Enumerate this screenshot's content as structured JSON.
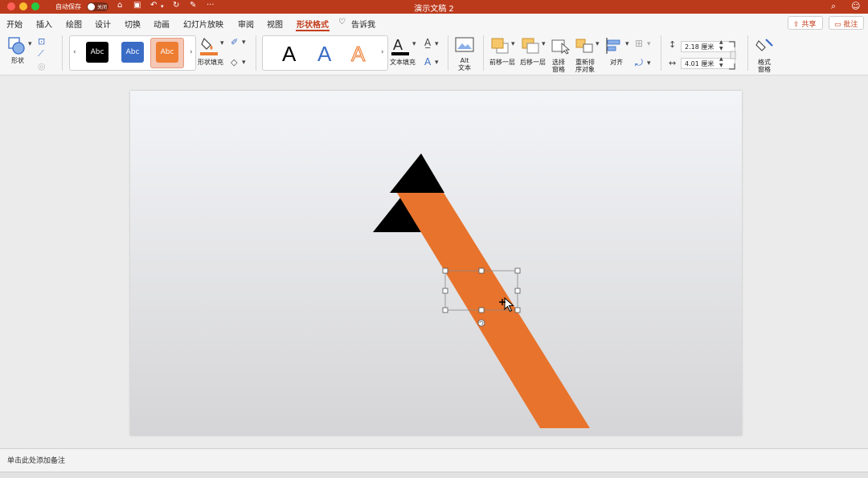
{
  "titlebar": {
    "autosave_label": "自动保存",
    "autosave_state": "关闭",
    "doc_title": "演示文稿 2",
    "more": "···"
  },
  "tabs": [
    "开始",
    "插入",
    "绘图",
    "设计",
    "切换",
    "动画",
    "幻灯片放映",
    "审阅",
    "视图",
    "形状格式"
  ],
  "tell_me": "告诉我",
  "share_label": "共享",
  "comment_label": "批注",
  "ribbon": {
    "shape_label": "形状",
    "style_sample": "Abc",
    "shape_fill_label": "形状填充",
    "wordart_sample": "A",
    "text_fill_label": "文本填充",
    "alt_text_label": "Alt\n文本",
    "bring_forward": "前移一层",
    "send_backward": "后移一层",
    "selection_pane": "选择\n窗格",
    "reorder_objects": "重新排\n序对象",
    "align": "对齐",
    "height_value": "2.18 厘米",
    "width_value": "4.01 厘米",
    "format_pane": "格式\n窗格"
  },
  "colors": {
    "brand": "#bc3a1c",
    "arrow_orange": "#e8732c",
    "arrow_black": "#000000",
    "style_black": "#000000",
    "style_blue": "#3a6cc6",
    "style_orange": "#ed7d31"
  },
  "notes_placeholder": "单击此处添加备注"
}
